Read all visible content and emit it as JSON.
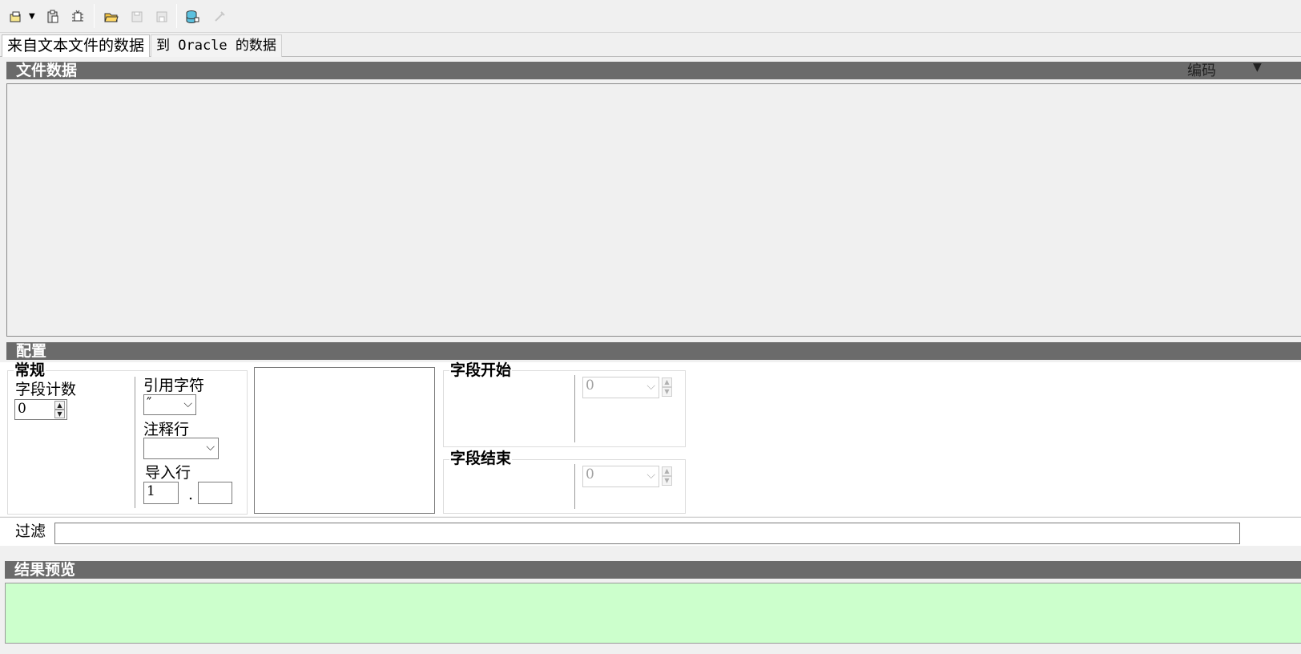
{
  "toolbar": {
    "buttons": [
      {
        "icon": "new-connection-dropdown-icon",
        "enabled": true
      },
      {
        "icon": "clipboard-icon",
        "enabled": true
      },
      {
        "icon": "debug-icon",
        "enabled": true
      },
      {
        "icon": "open-folder-icon",
        "enabled": true
      },
      {
        "icon": "save-icon",
        "enabled": false
      },
      {
        "icon": "save-as-icon",
        "enabled": false
      },
      {
        "icon": "database-import-icon",
        "enabled": true
      },
      {
        "icon": "execute-icon",
        "enabled": false
      }
    ]
  },
  "tabs": {
    "source": "来自文本文件的数据",
    "target": "到 Oracle 的数据"
  },
  "file_section": {
    "title": "文件数据",
    "encoding_label": "编码"
  },
  "config_section": {
    "title": "配置",
    "general": {
      "title": "常规",
      "field_count_label": "字段计数",
      "field_count_value": "0",
      "quote_char_label": "引用字符",
      "quote_char_value": "″",
      "comment_label": "注释行",
      "comment_value": "",
      "import_rows_label": "导入行",
      "import_from": "1",
      "import_sep": ".",
      "import_to": ""
    },
    "field_start": {
      "title": "字段开始",
      "value": "0"
    },
    "field_end": {
      "title": "字段结束",
      "value": "0"
    }
  },
  "filter": {
    "label": "过滤",
    "value": ""
  },
  "result_section": {
    "title": "结果预览"
  },
  "colors": {
    "header_bg": "#6b6b6b",
    "result_bg": "#ccffcc",
    "window_bg": "#f0f0f0"
  }
}
